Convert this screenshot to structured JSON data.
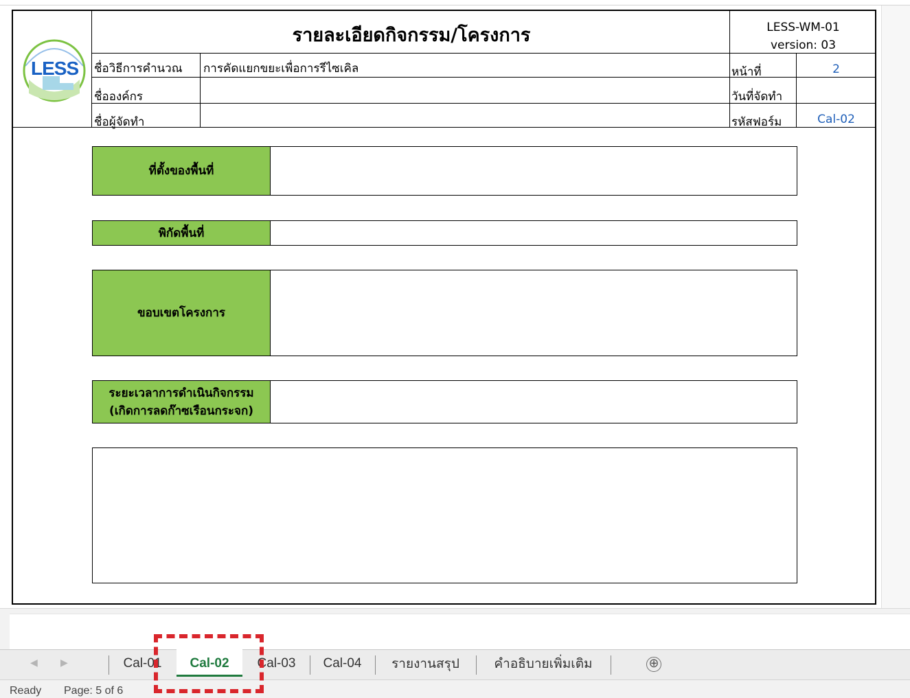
{
  "header": {
    "title": "รายละเอียดกิจกรรม/โครงการ",
    "doc_code": "LESS-WM-01",
    "doc_version": "version: 03",
    "logo_text": "LESS",
    "rows": [
      {
        "label": "ชื่อวิธีการคำนวณ",
        "value": "การคัดแยกขยะเพื่อการรีไซเคิล"
      },
      {
        "label": "ชื่อองค์กร",
        "value": ""
      },
      {
        "label": "ชื่อผู้จัดทำ",
        "value": ""
      }
    ],
    "right_rows": [
      {
        "label": "หน้าที่",
        "value": "2"
      },
      {
        "label": "วันที่จัดทำ",
        "value": ""
      },
      {
        "label": "รหัสฟอร์ม",
        "value": "Cal-02"
      }
    ]
  },
  "form": {
    "location_label": "ที่ตั้งของพื้นที่",
    "coords_label": "พิกัดพื้นที่",
    "scope_label": "ขอบเขตโครงการ",
    "period_label_1": "ระยะเวลาการดำเนินกิจกรรม",
    "period_label_2": "(เกิดการลดก๊าซเรือนกระจก)"
  },
  "tabs": [
    {
      "label": "Cal-01"
    },
    {
      "label": "Cal-02"
    },
    {
      "label": "Cal-03"
    },
    {
      "label": "Cal-04"
    },
    {
      "label": "รายงานสรุป"
    },
    {
      "label": "คำอธิบายเพิ่มเติม"
    }
  ],
  "active_tab": "Cal-02",
  "add_tab_symbol": "⊕",
  "status": {
    "ready": "Ready",
    "page": "Page: 5 of 6"
  },
  "colors": {
    "header_fill": "#8cc752",
    "highlight": "#d9262c",
    "active_tab_underline": "#1f7a3e",
    "value_blue": "#1f5fb8"
  }
}
